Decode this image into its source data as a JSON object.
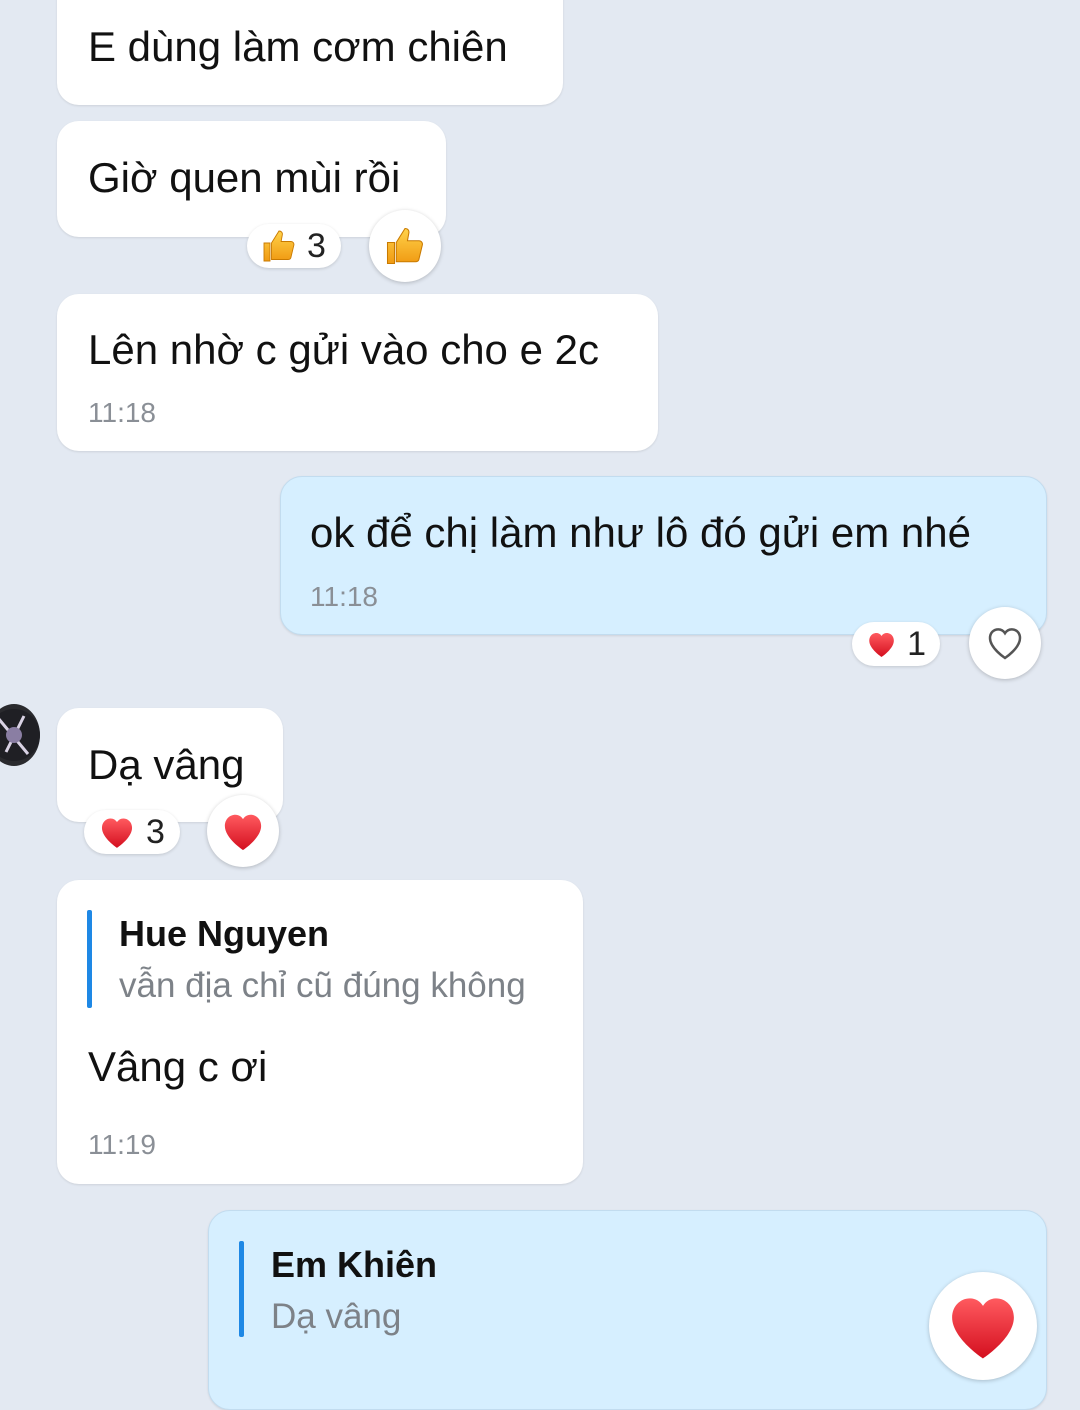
{
  "messages": [
    {
      "text": "E dùng làm cơm chiên"
    },
    {
      "text": "Giờ quen mùi rồi",
      "reaction_count": "3",
      "reaction_icon": "thumbs-up-icon"
    },
    {
      "text": "Lên nhờ c gửi vào cho e 2c",
      "time": "11:18"
    },
    {
      "text": "ok để chị làm như lô đó gửi em nhé",
      "time": "11:18",
      "reaction_count": "1",
      "reaction_icon": "heart-icon"
    },
    {
      "text": "Dạ vâng",
      "reaction_count": "3",
      "reaction_icon": "heart-icon"
    },
    {
      "quote_name": "Hue Nguyen",
      "quote_text": "vẫn địa chỉ cũ đúng không",
      "text": "Vâng c ơi",
      "time": "11:19"
    },
    {
      "quote_name": "Em Khiên",
      "quote_text": "Dạ vâng"
    }
  ],
  "colors": {
    "background": "#e3e9f2",
    "incoming_bubble": "#ffffff",
    "outgoing_bubble": "#d6efff",
    "quote_bar": "#1e88e5",
    "heart": "#e8202e",
    "thumb": "#f5b026"
  }
}
